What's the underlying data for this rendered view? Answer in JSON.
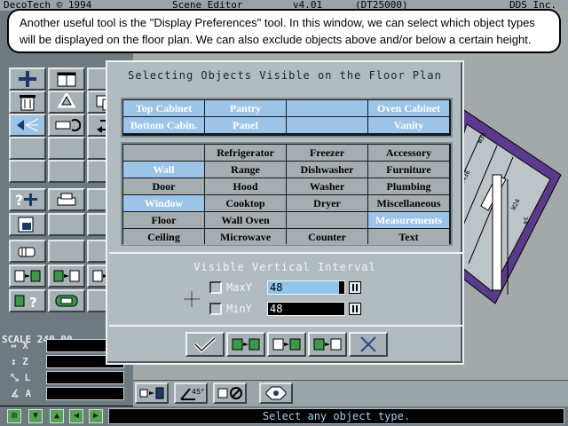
{
  "menubar": {
    "app": "DecoTech © 1994",
    "title": "Scene Editor",
    "version": "v4.01",
    "build": "(DT25000)",
    "company": "DDS Inc."
  },
  "tooltip": {
    "text": "Another useful tool is the \"Display Preferences\" tool. In this window, we can select which object types will be displayed on the floor plan. We can also exclude objects above and/or below a certain height."
  },
  "dialog": {
    "title": "Selecting Objects Visible on the Floor Plan",
    "cabinets": [
      [
        {
          "label": "Top Cabinet",
          "selected": true
        },
        {
          "label": "Pantry",
          "selected": true
        },
        {
          "label": "",
          "selected": true
        },
        {
          "label": "Oven Cabinet",
          "selected": true
        }
      ],
      [
        {
          "label": "Bottom Cabin.",
          "selected": true
        },
        {
          "label": "Panel",
          "selected": true
        },
        {
          "label": "",
          "selected": true
        },
        {
          "label": "Vanity",
          "selected": true
        }
      ]
    ],
    "objects": [
      [
        {
          "label": "",
          "selected": false
        },
        {
          "label": "Refrigerator",
          "selected": false
        },
        {
          "label": "Freezer",
          "selected": false
        },
        {
          "label": "Accessory",
          "selected": false
        }
      ],
      [
        {
          "label": "Wall",
          "selected": true
        },
        {
          "label": "Range",
          "selected": false
        },
        {
          "label": "Dishwasher",
          "selected": false
        },
        {
          "label": "Furniture",
          "selected": false
        }
      ],
      [
        {
          "label": "Door",
          "selected": false
        },
        {
          "label": "Hood",
          "selected": false
        },
        {
          "label": "Washer",
          "selected": false
        },
        {
          "label": "Plumbing",
          "selected": false
        }
      ],
      [
        {
          "label": "Window",
          "selected": true
        },
        {
          "label": "Cooktop",
          "selected": false
        },
        {
          "label": "Dryer",
          "selected": false
        },
        {
          "label": "Miscellaneous",
          "selected": false
        }
      ],
      [
        {
          "label": "Floor",
          "selected": false
        },
        {
          "label": "Wall Oven",
          "selected": false
        },
        {
          "label": "",
          "selected": false
        },
        {
          "label": "Measurements",
          "selected": true
        }
      ],
      [
        {
          "label": "Ceiling",
          "selected": false
        },
        {
          "label": "Microwave",
          "selected": false
        },
        {
          "label": "Counter",
          "selected": false
        },
        {
          "label": "Text",
          "selected": false
        }
      ]
    ],
    "interval": {
      "title": "Visible Vertical Interval",
      "max_label": "MaxY",
      "max_value": "48",
      "min_label": "MinY",
      "min_value": "48"
    }
  },
  "left_panel": {
    "scale_label": "SCALE 240.00",
    "coords": [
      {
        "label": "X",
        "value": ""
      },
      {
        "label": "Z",
        "value": ""
      },
      {
        "label": "L",
        "value": ""
      },
      {
        "label": "A",
        "value": ""
      }
    ]
  },
  "plan_labels": [
    "W36",
    "W2436",
    "W2130",
    "W24",
    "34"
  ],
  "status": {
    "text": "Select any object type."
  },
  "colors": {
    "selected": "#9cc4e8",
    "panel": "#b2bcc0",
    "toolbox": "#6f7a80"
  }
}
